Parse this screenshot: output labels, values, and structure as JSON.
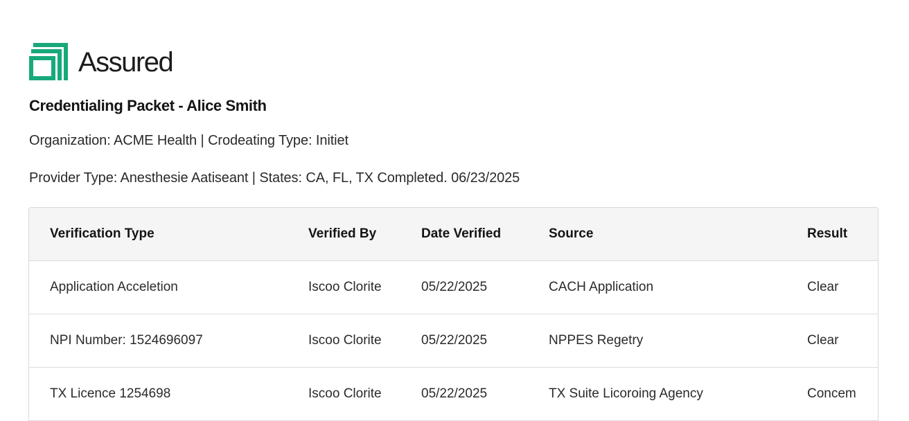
{
  "brand": {
    "name": "Assured",
    "logo_icon": "assured-stacked-frames-icon",
    "accent_color": "#18a97b"
  },
  "packet": {
    "title": "Credentialing Packet - Alice Smith",
    "line1": "Organization: ACME Health | Crodeating Type: Initiet",
    "line2": "Provider Type: Anesthesie Aatiseant | States: CA, FL, TX  Completed. 06/23/2025"
  },
  "table": {
    "headers": {
      "verification_type": "Verification Type",
      "verified_by": "Verified By",
      "date_verified": "Date Verified",
      "source": "Source",
      "result": "Result"
    },
    "rows": [
      {
        "verification_type": "Application Acceletion",
        "verified_by": "Iscoo Clorite",
        "date_verified": "05/22/2025",
        "source": "CACH Application",
        "result": "Clear"
      },
      {
        "verification_type": "NPI Number: 1524696097",
        "verified_by": "Iscoo Clorite",
        "date_verified": "05/22/2025",
        "source": "NPPES Regetry",
        "result": "Clear"
      },
      {
        "verification_type": "TX Licence 1254698",
        "verified_by": "Iscoo Clorite",
        "date_verified": "05/22/2025",
        "source": "TX Suite Licoroing Agency",
        "result": "Concem"
      }
    ]
  }
}
